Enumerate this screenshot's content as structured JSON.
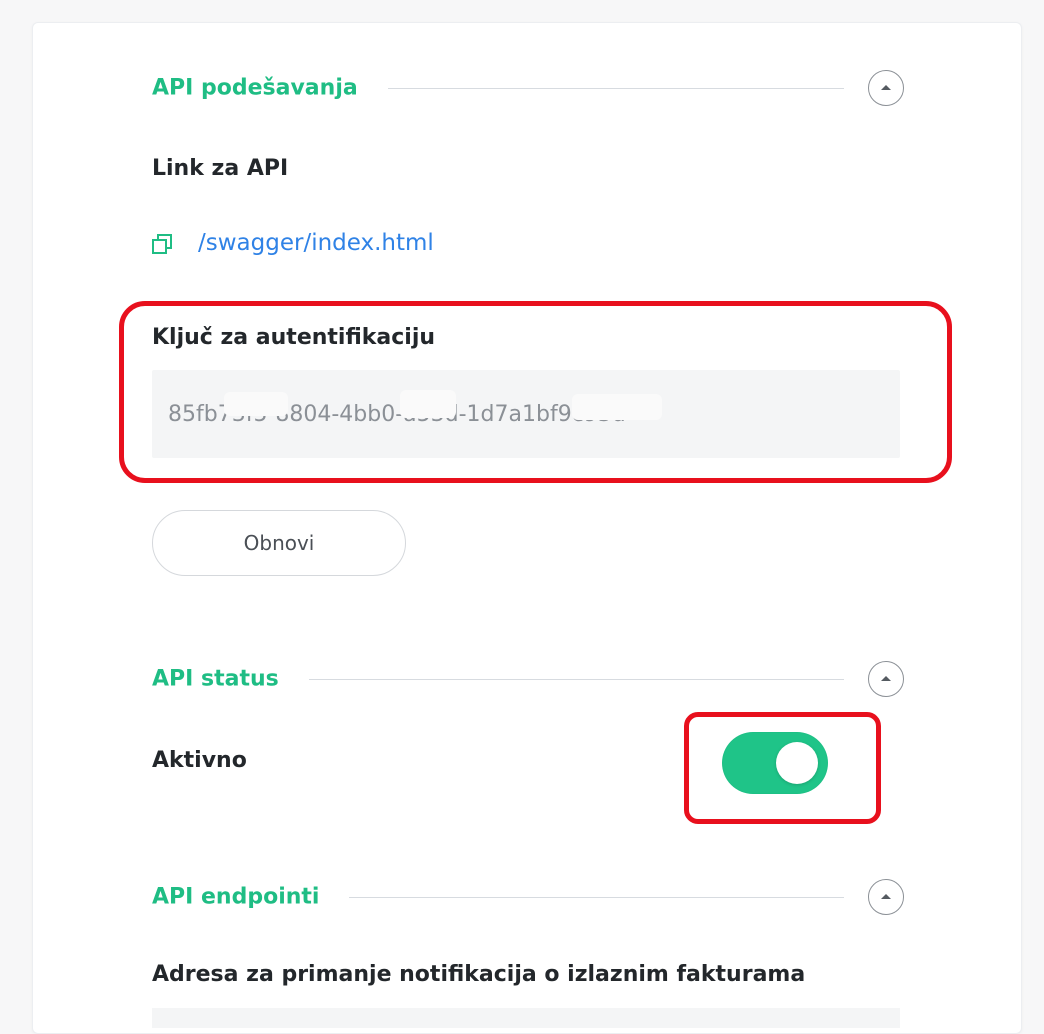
{
  "sections": {
    "api_settings": {
      "title": "API podešavanja",
      "link_label": "Link za API",
      "link_text": "/swagger/index.html",
      "auth_key_label": "Ključ za autentifikaciju",
      "auth_key_value": "85fb73f5-8804-4bb0-a53d-1d7a1bf9c93d",
      "refresh_button": "Obnovi"
    },
    "api_status": {
      "title": "API status",
      "active_label": "Aktivno",
      "active": true
    },
    "api_endpoints": {
      "title": "API endpointi",
      "notification_label": "Adresa za primanje notifikacija o izlaznim fakturama"
    }
  },
  "icons": {
    "collapse": "chevron-up-icon",
    "copy": "copy-icon"
  },
  "colors": {
    "accent": "#1fbd84",
    "link": "#2f82e6",
    "highlight": "#e8101d",
    "toggle_on": "#1fc488"
  }
}
